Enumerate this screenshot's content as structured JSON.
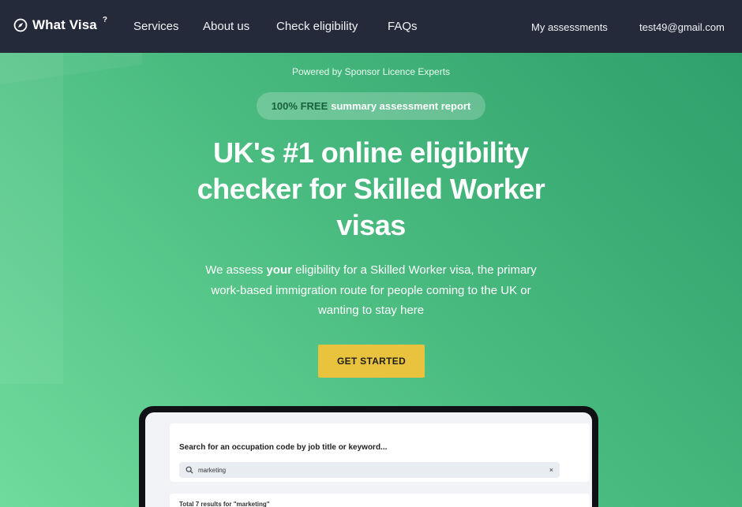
{
  "header": {
    "logo_text": "What Visa",
    "logo_sup": "?",
    "nav": [
      "Services",
      "About us",
      "Check eligibility",
      "FAQs"
    ],
    "my_assessments": "My assessments",
    "user_email": "test49@gmail.com"
  },
  "hero": {
    "powered_by": "Powered by Sponsor Licence Experts",
    "badge_free": "100% FREE",
    "badge_rest": "summary assessment report",
    "headline": "UK's #1 online eligibility checker for Skilled Worker visas",
    "desc_pre": "We assess ",
    "desc_bold": "your",
    "desc_post": " eligibility for a Skilled Worker visa, the primary work-based immigration route for people coming to the UK or wanting to stay here",
    "cta": "GET STARTED"
  },
  "preview": {
    "search_title": "Search for an occupation code by job title or keyword...",
    "search_value": "marketing",
    "clear_icon": "×",
    "results_text": "Total 7 results for \"marketing\""
  },
  "colors": {
    "nav_bg": "#252a3a",
    "hero_green": "#48b97e",
    "cta_yellow": "#e9c33d"
  },
  "icons": [
    "compass-icon",
    "search-icon",
    "close-icon"
  ]
}
